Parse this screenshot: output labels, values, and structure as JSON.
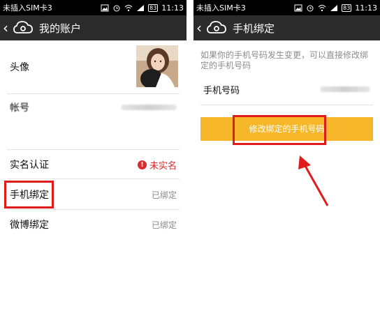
{
  "left": {
    "status": {
      "carrier": "未插入SIM卡3",
      "battery": "83",
      "time": "11:13"
    },
    "header": {
      "title": "我的账户"
    },
    "rows": [
      {
        "label": "头像"
      },
      {
        "label": "帐号"
      },
      {
        "label": "实名认证",
        "value": "未实名"
      },
      {
        "label": "手机绑定",
        "value": "已绑定"
      },
      {
        "label": "微博绑定",
        "value": "已绑定"
      }
    ]
  },
  "right": {
    "status": {
      "carrier": "未插入SIM卡3",
      "battery": "83",
      "time": "11:13"
    },
    "header": {
      "title": "手机绑定"
    },
    "description": "如果你的手机号码发生变更，可以直接修改绑定的手机号码",
    "phone_label": "手机号码",
    "button_label": "修改绑定的手机号码"
  },
  "colors": {
    "accent_button": "#f6b72a",
    "highlight": "#e01b1b",
    "titlebar": "#2c2c2c"
  }
}
